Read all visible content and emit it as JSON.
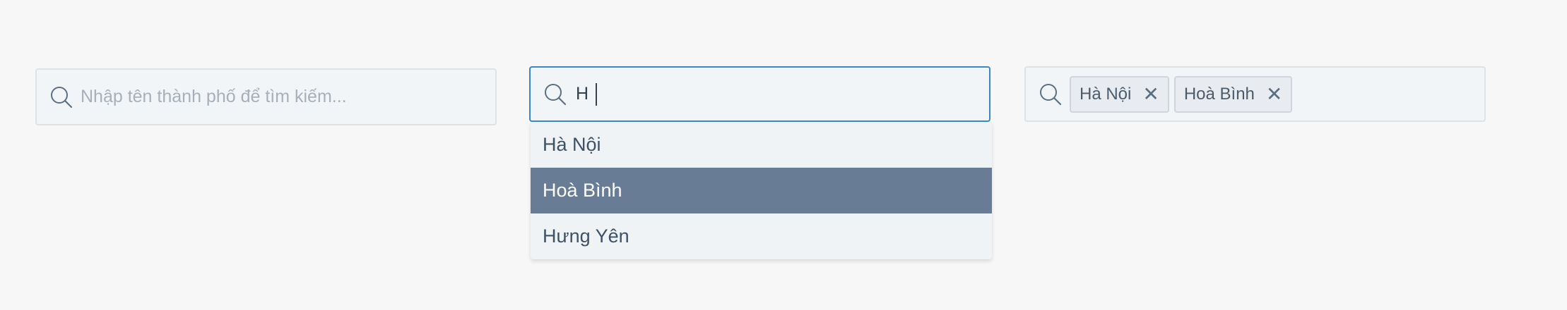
{
  "empty_search": {
    "placeholder": "Nhập tên thành phố để tìm kiếm...",
    "icon": "search-icon"
  },
  "typing_search": {
    "value": "H",
    "icon": "search-icon",
    "suggestions": [
      "Hà Nội",
      "Hoà Bình",
      "Hưng Yên"
    ],
    "highlighted_index": 1
  },
  "tag_search": {
    "icon": "search-icon",
    "tags": [
      {
        "label": "Hà Nội",
        "remove": "✕"
      },
      {
        "label": "Hoà Bình",
        "remove": "✕"
      }
    ]
  },
  "colors": {
    "page_bg": "#f7f7f7",
    "field_bg": "#f2f5f7",
    "focus_border": "#3b87c4",
    "highlight_bg": "#687d95"
  }
}
